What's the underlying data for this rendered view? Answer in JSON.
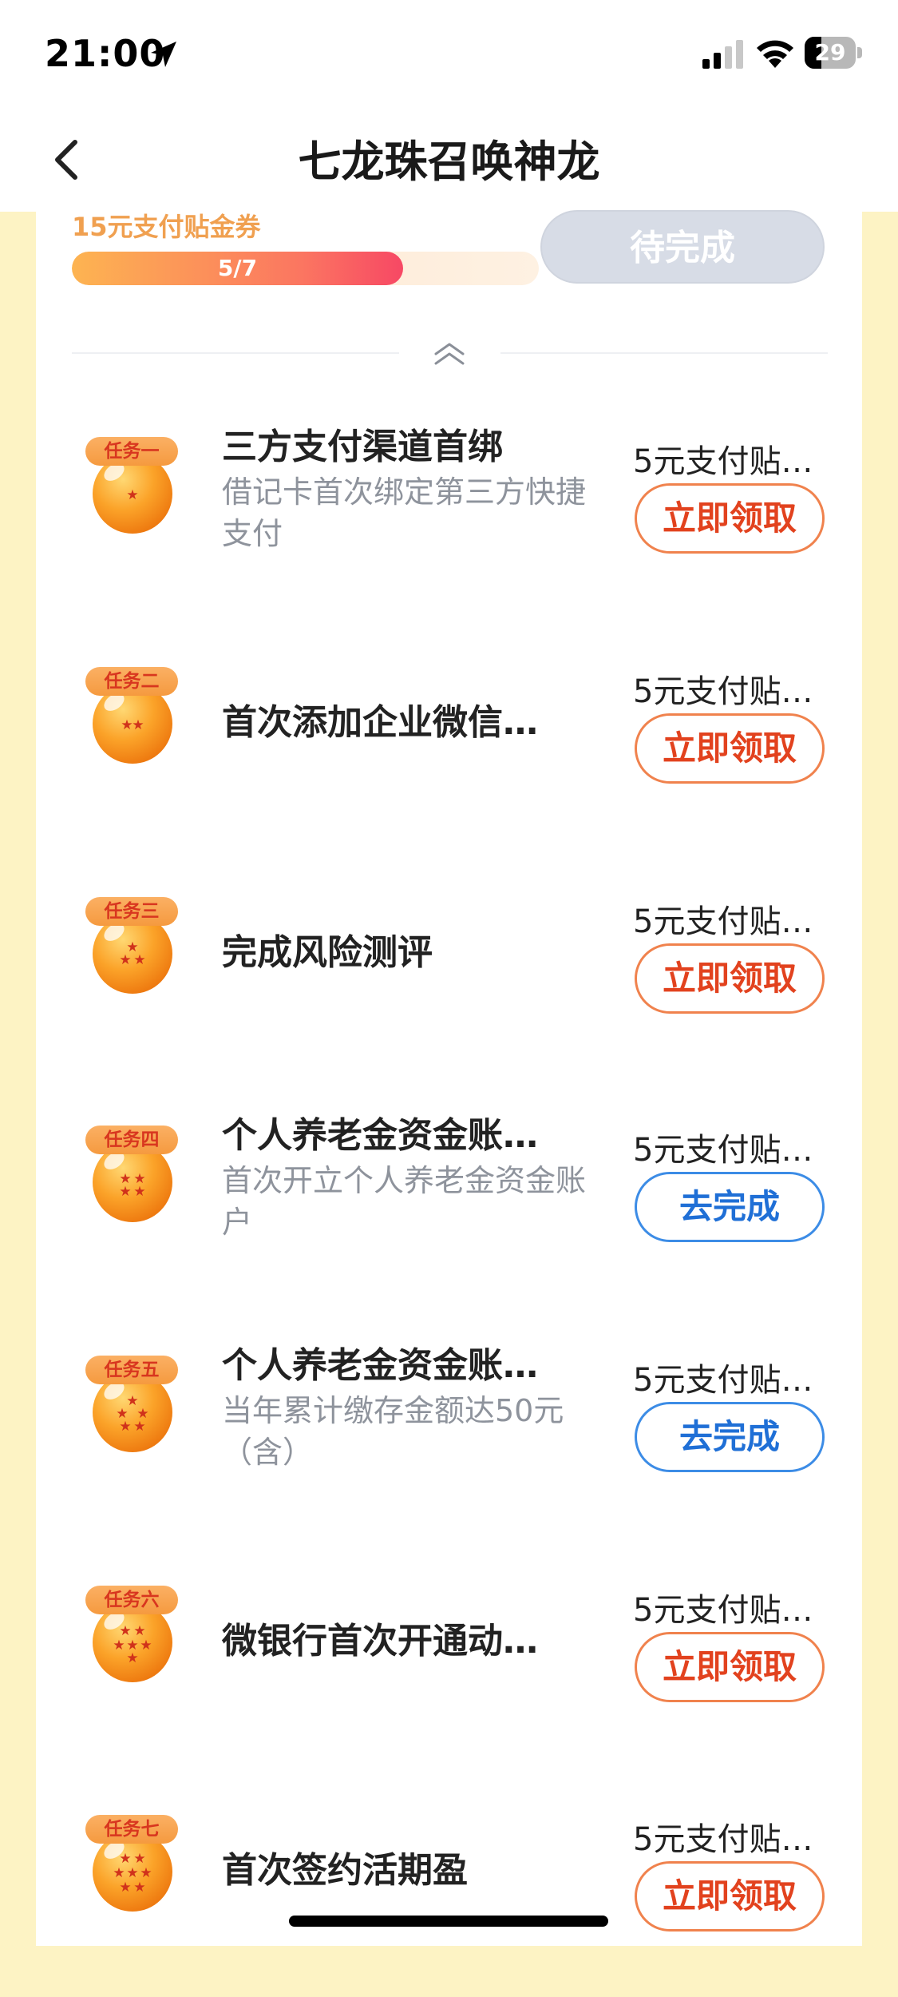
{
  "status_bar": {
    "time": "21:00",
    "battery": "29"
  },
  "nav": {
    "title": "七龙珠召唤神龙"
  },
  "summary": {
    "coupon_label": "15元支付贴金券",
    "progress_text": "5/7",
    "progress": 0.71,
    "button_label": "待完成"
  },
  "tasks": [
    {
      "badge": "任务一",
      "title": "三方支付渠道首绑",
      "desc": "借记卡首次绑定第三方快捷支付",
      "reward": "5元支付贴…",
      "button": "立即领取",
      "button_type": "claim"
    },
    {
      "badge": "任务二",
      "title": "首次添加企业微信…",
      "desc": "",
      "reward": "5元支付贴…",
      "button": "立即领取",
      "button_type": "claim"
    },
    {
      "badge": "任务三",
      "title": "完成风险测评",
      "desc": "",
      "reward": "5元支付贴…",
      "button": "立即领取",
      "button_type": "claim"
    },
    {
      "badge": "任务四",
      "title": "个人养老金资金账…",
      "desc": "首次开立个人养老金资金账户",
      "reward": "5元支付贴…",
      "button": "去完成",
      "button_type": "todo"
    },
    {
      "badge": "任务五",
      "title": "个人养老金资金账…",
      "desc": "当年累计缴存金额达50元（含）",
      "reward": "5元支付贴…",
      "button": "去完成",
      "button_type": "todo"
    },
    {
      "badge": "任务六",
      "title": "微银行首次开通动…",
      "desc": "",
      "reward": "5元支付贴…",
      "button": "立即领取",
      "button_type": "claim"
    },
    {
      "badge": "任务七",
      "title": "首次签约活期盈",
      "desc": "",
      "reward": "5元支付贴…",
      "button": "立即领取",
      "button_type": "claim"
    }
  ],
  "colors": {
    "accent_orange": "#e2421e",
    "accent_blue": "#1f6fd6",
    "page_bg": "#fdf3c4"
  }
}
